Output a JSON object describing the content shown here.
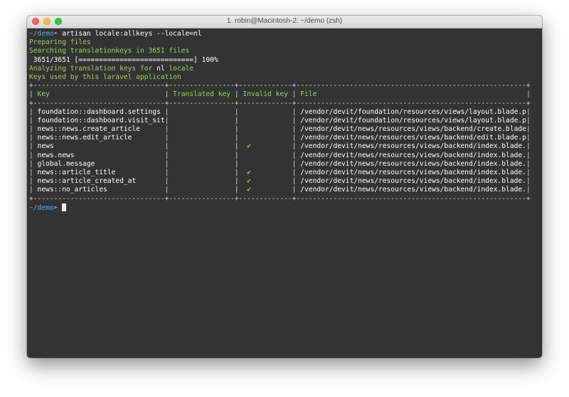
{
  "window": {
    "title": "1. robin@Macintosh-2: ~/demo (zsh)"
  },
  "prompt": {
    "path": "~/demo",
    "arrow": "➤",
    "command": "artisan locale:allkeys --locale=nl"
  },
  "output": {
    "preparing": "Preparing files",
    "searching": "Searching translationkeys in 3651 files",
    "progress": " 3651/3651 [============================] 100%",
    "progress_percent": 100,
    "analyzing_prefix": "Analyzing translation keys for ",
    "analyzing_locale": "nl",
    "analyzing_suffix": " locale",
    "keys_used": "Keys used by this laravel application"
  },
  "table": {
    "headers": {
      "key": "Key",
      "translated": "Translated key",
      "invalid": "Invalid key",
      "file": "File"
    },
    "rows": [
      {
        "key": "foundation::dashboard.settings",
        "translated": "",
        "invalid": "",
        "file": "/vendor/devit/foundation/resources/views/layout.blade.php"
      },
      {
        "key": "foundation::dashboard.visit_site",
        "translated": "",
        "invalid": "",
        "file": "/vendor/devit/foundation/resources/views/layout.blade.php"
      },
      {
        "key": "news::news.create_article",
        "translated": "",
        "invalid": "",
        "file": "/vendor/devit/news/resources/views/backend/create.blade.php"
      },
      {
        "key": "news::news.edit_article",
        "translated": "",
        "invalid": "",
        "file": "/vendor/devit/news/resources/views/backend/edit.blade.php"
      },
      {
        "key": "news",
        "translated": "",
        "invalid": "✔",
        "file": "/vendor/devit/news/resources/views/backend/index.blade.php"
      },
      {
        "key": "news.news",
        "translated": "",
        "invalid": "",
        "file": "/vendor/devit/news/resources/views/backend/index.blade.php"
      },
      {
        "key": "global.message",
        "translated": "",
        "invalid": "",
        "file": "/vendor/devit/news/resources/views/backend/index.blade.php"
      },
      {
        "key": "news::article_title",
        "translated": "",
        "invalid": "✔",
        "file": "/vendor/devit/news/resources/views/backend/index.blade.php"
      },
      {
        "key": "news::article_created_at",
        "translated": "",
        "invalid": "✔",
        "file": "/vendor/devit/news/resources/views/backend/index.blade.php"
      },
      {
        "key": "news::no_articles",
        "translated": "",
        "invalid": "✔",
        "file": "/vendor/devit/news/resources/views/backend/index.blade.php"
      }
    ]
  },
  "prompt2": {
    "path": "~/demo",
    "arrow": "➤"
  },
  "colors": {
    "background": "#333333",
    "prompt_path": "#5fa8dd",
    "output_green": "#9ed15c",
    "text": "#e6e6e6"
  }
}
